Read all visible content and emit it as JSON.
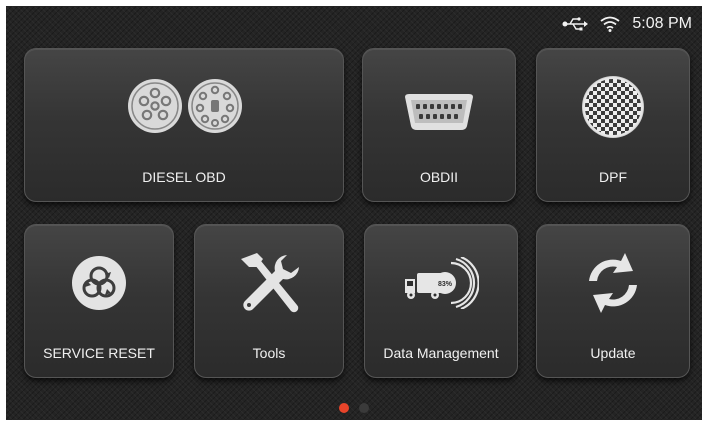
{
  "status_bar": {
    "time": "5:08 PM",
    "icons": [
      "usb-icon",
      "wifi-icon"
    ]
  },
  "tiles": [
    {
      "label": "DIESEL OBD",
      "icon": "diesel-connector-icon"
    },
    {
      "label": "OBDII",
      "icon": "obd2-connector-icon"
    },
    {
      "label": "DPF",
      "icon": "dpf-filter-icon"
    },
    {
      "label": "SERVICE RESET",
      "icon": "service-reset-icon"
    },
    {
      "label": "Tools",
      "icon": "tools-icon"
    },
    {
      "label": "Data Management",
      "icon": "truck-data-icon"
    },
    {
      "label": "Update",
      "icon": "update-icon"
    }
  ],
  "pager": {
    "pages": 2,
    "current": 1
  },
  "colors": {
    "active_dot": "#e8442a",
    "inactive_dot": "#3a3a3a",
    "background": "#242424"
  }
}
